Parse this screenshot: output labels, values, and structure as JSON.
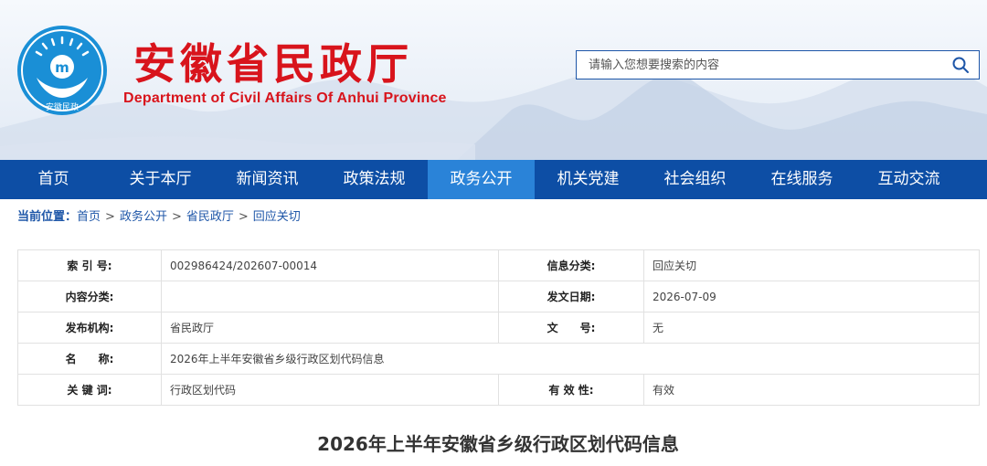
{
  "header": {
    "logo_text": "安徽民政",
    "title": "安徽省民政厅",
    "subtitle": "Department of Civil Affairs Of Anhui Province",
    "search_placeholder": "请输入您想要搜索的内容"
  },
  "nav": {
    "items": [
      "首页",
      "关于本厅",
      "新闻资讯",
      "政策法规",
      "政务公开",
      "机关党建",
      "社会组织",
      "在线服务",
      "互动交流"
    ],
    "active": "政务公开"
  },
  "breadcrumb": {
    "lead": "当前位置：",
    "items": [
      "首页",
      "政务公开",
      "省民政厅",
      "回应关切"
    ]
  },
  "info": {
    "index_label": "索 引 号:",
    "index_value": "002986424/202607-00014",
    "category_label": "信息分类:",
    "category_value": "回应关切",
    "content_label": "内容分类:",
    "content_value": "",
    "date_label": "发文日期:",
    "date_value": "2026-07-09",
    "org_label": "发布机构:",
    "org_value": "省民政厅",
    "docno_label": "文　　号:",
    "docno_value": "无",
    "name_label": "名　　称:",
    "name_value": "2026年上半年安徽省乡级行政区划代码信息",
    "keyword_label": "关 键 词:",
    "keyword_value": "行政区划代码",
    "validity_label": "有 效 性:",
    "validity_value": "有效"
  },
  "document": {
    "title": "2026年上半年安徽省乡级行政区划代码信息"
  },
  "colors": {
    "brand_red": "#d8141c",
    "nav_blue": "#0d4ea5",
    "nav_active": "#2a83d8",
    "emblem_blue": "#1a8fd6"
  }
}
